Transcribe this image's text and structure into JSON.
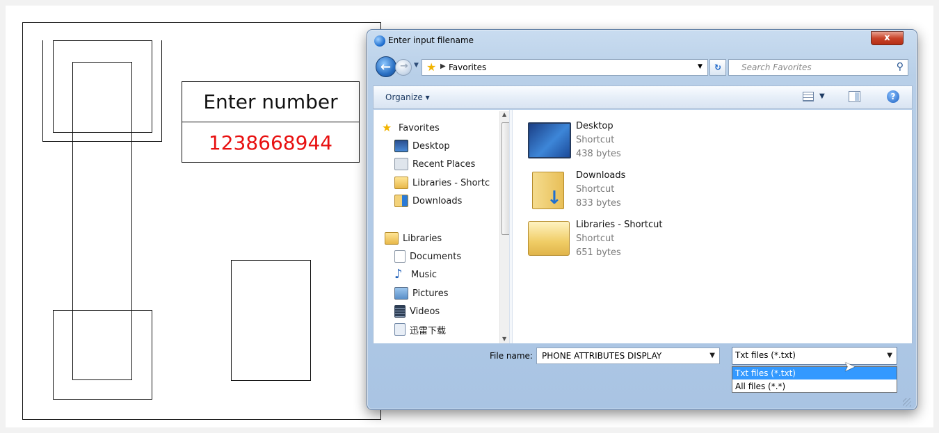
{
  "background": {
    "number_box": {
      "title": "Enter number",
      "value": "1238668944",
      "value_color": "#e81010"
    }
  },
  "dialog": {
    "title": "Enter input filename",
    "close_label": "x",
    "address": {
      "location": "Favorites"
    },
    "search_placeholder": "Search Favorites",
    "toolbar": {
      "organize_label": "Organize ▾"
    },
    "nav_pane": {
      "items": [
        {
          "label": "Favorites",
          "icon": "star-icon"
        },
        {
          "label": "Desktop",
          "icon": "desktop-icon"
        },
        {
          "label": "Recent Places",
          "icon": "recent-places-icon"
        },
        {
          "label": "Libraries - Shortc",
          "icon": "library-icon"
        },
        {
          "label": "Downloads",
          "icon": "downloads-icon"
        },
        {
          "label": "Libraries",
          "icon": "library-icon"
        },
        {
          "label": "Documents",
          "icon": "document-icon"
        },
        {
          "label": "Music",
          "icon": "music-icon"
        },
        {
          "label": "Pictures",
          "icon": "pictures-icon"
        },
        {
          "label": "Videos",
          "icon": "videos-icon"
        },
        {
          "label": "迅雷下载",
          "icon": "folder-icon"
        }
      ]
    },
    "files": [
      {
        "name": "Desktop",
        "type": "Shortcut",
        "size": "438 bytes",
        "icon": "desktop-icon"
      },
      {
        "name": "Downloads",
        "type": "Shortcut",
        "size": "833 bytes",
        "icon": "downloads-folder-icon"
      },
      {
        "name": "Libraries - Shortcut",
        "type": "Shortcut",
        "size": "651 bytes",
        "icon": "library-folder-icon"
      }
    ],
    "file_name_label": "File name:",
    "file_name_value": "PHONE ATTRIBUTES DISPLAY",
    "file_type_selected": "Txt files (*.txt)",
    "file_type_options": [
      "Txt files (*.txt)",
      "All files (*.*)"
    ]
  }
}
